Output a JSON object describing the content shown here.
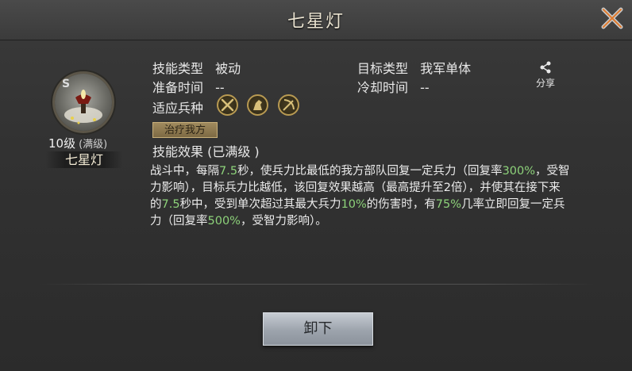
{
  "header": {
    "title": "七星灯"
  },
  "skill": {
    "avatar_badge": "S",
    "level": "10级",
    "level_note": "(满级)",
    "name": "七星灯"
  },
  "info": {
    "type_label": "技能类型",
    "type_value": "被动",
    "target_label": "目标类型",
    "target_value": "我军单体",
    "prep_label": "准备时间",
    "prep_value": "--",
    "cooldown_label": "冷却时间",
    "cooldown_value": "--",
    "troops_label": "适应兵种",
    "troop_icons": [
      "spear-icon",
      "cavalry-icon",
      "archer-icon"
    ],
    "share_label": "分享"
  },
  "tag": "治疗我方",
  "effect": {
    "title": "技能效果 (已满级 )",
    "parts": [
      "战斗中，每隔",
      "7.5",
      "秒，使兵力比最低的我方部队回复一定兵力（回复率",
      "300%",
      "，受智力影响），目标兵力比越低，该回复效果越高（最高提升至2倍），并使其在接下来的",
      "7.5",
      "秒中，受到单次超过其最大兵力",
      "10%",
      "的伤害时，有",
      "75%",
      "几率立即回复一定兵力（回复率",
      "500%",
      "，受智力影响）。"
    ]
  },
  "button": {
    "unequip": "卸下"
  },
  "colors": {
    "highlight": "#8dd27a",
    "gold": "#b89a52"
  }
}
